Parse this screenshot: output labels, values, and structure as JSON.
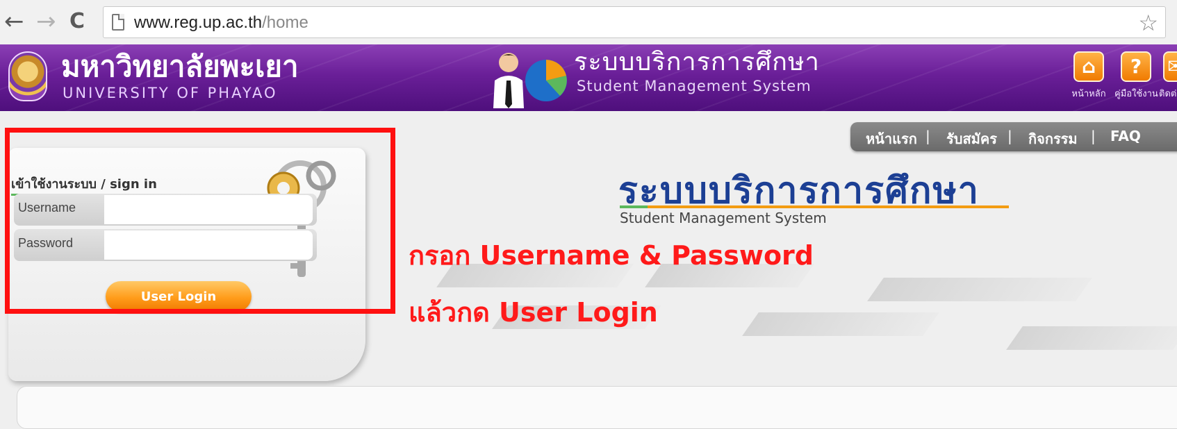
{
  "browser": {
    "back": "←",
    "forward": "→",
    "reload": "C",
    "url_host": "www.reg.up.ac.th",
    "url_path": "/home",
    "bookmark_star": "☆"
  },
  "header": {
    "university_thai": "มหาวิทยาลัยพะเยา",
    "university_english": "UNIVERSITY OF PHAYAO",
    "system_thai": "ระบบบริการการศึกษา",
    "system_english": "Student Management System",
    "buttons": [
      {
        "icon": "home-icon",
        "glyph": "⌂",
        "label": "หน้าหลัก"
      },
      {
        "icon": "help-icon",
        "glyph": "?",
        "label": "คู่มือใช้งาน"
      },
      {
        "icon": "mail-icon",
        "glyph": "✉",
        "label": "ติดต่อ"
      }
    ]
  },
  "topnav": {
    "items": [
      "หน้าแรก",
      "รับสมัคร",
      "กิจกรรม",
      "FAQ"
    ],
    "separator": "|"
  },
  "login": {
    "title": "เข้าใช้งานระบบ / sign in",
    "username_label": "Username",
    "password_label": "Password",
    "button": "User Login"
  },
  "main": {
    "title": "ระบบบริการการศึกษา",
    "subtitle": "Student Management System"
  },
  "annotation": {
    "line1": "กรอก Username & Password",
    "line2": "แล้วกด User Login"
  },
  "colors": {
    "header_purple": "#6a1f98",
    "accent_orange": "#f39c12",
    "accent_green": "#5cb85c",
    "title_blue": "#1c3f94",
    "annotation_red": "#ff1a1a"
  }
}
